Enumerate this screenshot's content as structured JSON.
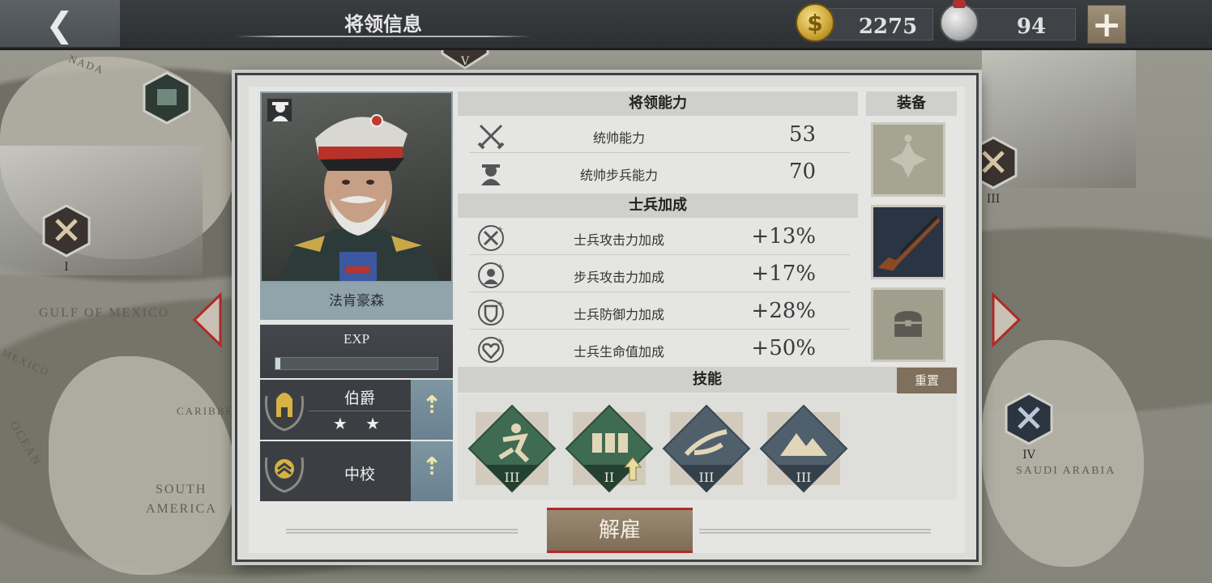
{
  "header": {
    "back_icon": "chevron-left-icon",
    "title": "将领信息",
    "gold": "2275",
    "gold_icon": "dollar-coin-icon",
    "medals": "94",
    "medal_icon": "silver-medal-icon",
    "add_label": "+"
  },
  "map": {
    "labels": [
      "GULF OF MEXICO",
      "SOUTH",
      "AMERICA",
      "SAUDI ARABIA",
      "MEXICO",
      "CARIBBE",
      "OCEAN",
      "NADA"
    ],
    "markers": [
      "I",
      "III",
      "IV",
      "V"
    ]
  },
  "general": {
    "name": "法肯豪森",
    "exp_label": "EXP",
    "exp_progress": 0.02,
    "rank_title": "伯爵",
    "rank_stars": "★ ★",
    "military_rank": "中校",
    "upgrade_icon": "double-up-arrow-icon"
  },
  "abilities": {
    "header": "将领能力",
    "rows": [
      {
        "icon": "crossed-swords-icon",
        "name": "统帅能力",
        "value": "53"
      },
      {
        "icon": "infantry-helmet-icon",
        "name": "统帅步兵能力",
        "value": "70"
      }
    ]
  },
  "bonuses": {
    "header": "士兵加成",
    "rows": [
      {
        "icon": "swords-plus-icon",
        "name": "士兵攻击力加成",
        "value": "+13%"
      },
      {
        "icon": "soldier-plus-icon",
        "name": "步兵攻击力加成",
        "value": "+17%"
      },
      {
        "icon": "shield-plus-icon",
        "name": "士兵防御力加成",
        "value": "+28%"
      },
      {
        "icon": "heart-plus-icon",
        "name": "士兵生命值加成",
        "value": "+50%"
      }
    ]
  },
  "equipment": {
    "header": "装备",
    "slots": [
      "iron-cross-medal-icon",
      "rifle-icon",
      "chest-icon"
    ]
  },
  "skills": {
    "header": "技能",
    "reset_label": "重置",
    "items": [
      {
        "icon": "running-soldier-icon",
        "level": "III",
        "color": "#3f6b52"
      },
      {
        "icon": "soldiers-march-icon",
        "level": "II",
        "color": "#3f6b52"
      },
      {
        "icon": "cavalry-charge-icon",
        "level": "III",
        "color": "#4f5f6c"
      },
      {
        "icon": "mountain-icon",
        "level": "III",
        "color": "#4f5f6c"
      }
    ]
  },
  "actions": {
    "dismiss_label": "解雇"
  },
  "colors": {
    "topbar": "#2f3235",
    "accent_red": "#b02a2a",
    "skill_green": "#3f6b52",
    "skill_slate": "#4f5f6c",
    "button_tan": "#8a7a64"
  }
}
